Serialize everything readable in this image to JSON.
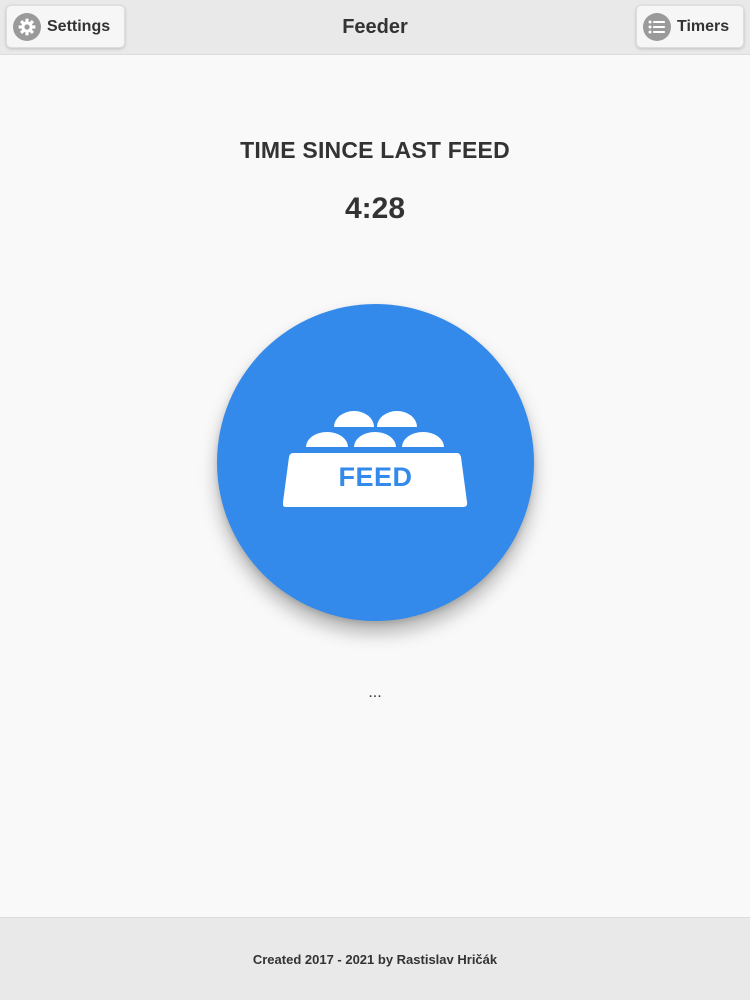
{
  "header": {
    "title": "Feeder",
    "settings_button": {
      "label": "Settings",
      "icon": "gear-icon"
    },
    "timers_button": {
      "label": "Timers",
      "icon": "list-icon"
    }
  },
  "main": {
    "since_label": "TIME SINCE LAST FEED",
    "since_value": "4:28",
    "feed_button": {
      "label": "FEED",
      "icon": "food-bowl-icon"
    },
    "status_text": "..."
  },
  "footer": {
    "text": "Created 2017 - 2021 by Rastislav Hričák"
  },
  "colors": {
    "accent": "#338aea",
    "bar_background": "#e9e9e9",
    "page_background": "#f9f9f9",
    "text": "#333333",
    "icon_disc": "#9a9a9a"
  }
}
